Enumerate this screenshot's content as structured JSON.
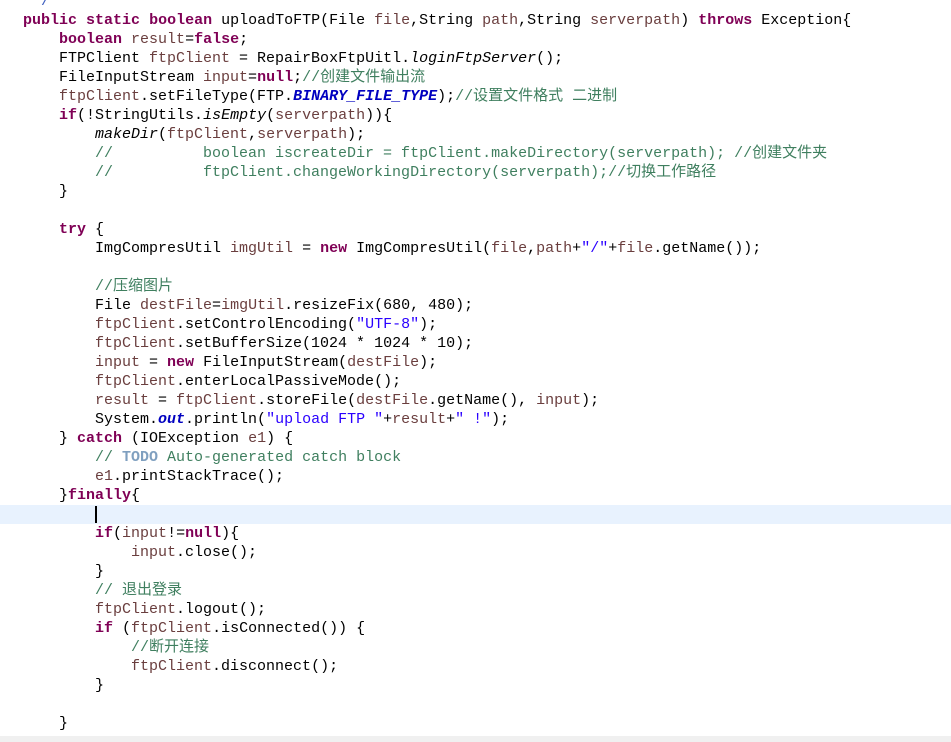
{
  "editor": {
    "current_line": 27,
    "lines": [
      [
        [
          " */",
          "j"
        ]
      ],
      [
        [
          "public",
          "k"
        ],
        [
          " ",
          "p"
        ],
        [
          "static",
          "k"
        ],
        [
          " ",
          "p"
        ],
        [
          "boolean",
          "k"
        ],
        [
          " uploadToFTP(File ",
          "p"
        ],
        [
          "file",
          "v"
        ],
        [
          ",String ",
          "p"
        ],
        [
          "path",
          "v"
        ],
        [
          ",String ",
          "p"
        ],
        [
          "serverpath",
          "v"
        ],
        [
          ") ",
          "p"
        ],
        [
          "throws",
          "k"
        ],
        [
          " Exception{",
          "p"
        ]
      ],
      [
        [
          "    ",
          "p"
        ],
        [
          "boolean",
          "k"
        ],
        [
          " ",
          "p"
        ],
        [
          "result",
          "v"
        ],
        [
          "=",
          "p"
        ],
        [
          "false",
          "k"
        ],
        [
          ";",
          "p"
        ]
      ],
      [
        [
          "    FTPClient ",
          "p"
        ],
        [
          "ftpClient",
          "v"
        ],
        [
          " = RepairBoxFtpUitl.",
          "p"
        ],
        [
          "loginFtpServer",
          "i"
        ],
        [
          "();",
          "p"
        ]
      ],
      [
        [
          "    FileInputStream ",
          "p"
        ],
        [
          "input",
          "v"
        ],
        [
          "=",
          "p"
        ],
        [
          "null",
          "k"
        ],
        [
          ";",
          "p"
        ],
        [
          "//创建文件输出流",
          "c"
        ]
      ],
      [
        [
          "    ",
          "p"
        ],
        [
          "ftpClient",
          "v"
        ],
        [
          ".setFileType(FTP.",
          "p"
        ],
        [
          "BINARY_FILE_TYPE",
          "f"
        ],
        [
          ");",
          "p"
        ],
        [
          "//设置文件格式 二进制",
          "c"
        ]
      ],
      [
        [
          "    ",
          "p"
        ],
        [
          "if",
          "k"
        ],
        [
          "(!StringUtils.",
          "p"
        ],
        [
          "isEmpty",
          "i"
        ],
        [
          "(",
          "p"
        ],
        [
          "serverpath",
          "v"
        ],
        [
          ")){",
          "p"
        ]
      ],
      [
        [
          "        ",
          "p"
        ],
        [
          "makeDir",
          "i"
        ],
        [
          "(",
          "p"
        ],
        [
          "ftpClient",
          "v"
        ],
        [
          ",",
          "p"
        ],
        [
          "serverpath",
          "v"
        ],
        [
          ");",
          "p"
        ]
      ],
      [
        [
          "        //          boolean iscreateDir = ftpClient.makeDirectory(serverpath); //创建文件夹",
          "c"
        ]
      ],
      [
        [
          "        //          ftpClient.changeWorkingDirectory(serverpath);//切换工作路径",
          "c"
        ]
      ],
      [
        [
          "    }",
          "p"
        ]
      ],
      [],
      [
        [
          "    ",
          "p"
        ],
        [
          "try",
          "k"
        ],
        [
          " {",
          "p"
        ]
      ],
      [
        [
          "        ImgCompresUtil ",
          "p"
        ],
        [
          "imgUtil",
          "v"
        ],
        [
          " = ",
          "p"
        ],
        [
          "new",
          "k"
        ],
        [
          " ImgCompresUtil(",
          "p"
        ],
        [
          "file",
          "v"
        ],
        [
          ",",
          "p"
        ],
        [
          "path",
          "v"
        ],
        [
          "+",
          "p"
        ],
        [
          "\"/\"",
          "s"
        ],
        [
          "+",
          "p"
        ],
        [
          "file",
          "v"
        ],
        [
          ".getName());",
          "p"
        ]
      ],
      [],
      [
        [
          "        //压缩图片",
          "c"
        ]
      ],
      [
        [
          "        File ",
          "p"
        ],
        [
          "destFile",
          "v"
        ],
        [
          "=",
          "p"
        ],
        [
          "imgUtil",
          "v"
        ],
        [
          ".resizeFix(680, 480);",
          "p"
        ]
      ],
      [
        [
          "        ",
          "p"
        ],
        [
          "ftpClient",
          "v"
        ],
        [
          ".setControlEncoding(",
          "p"
        ],
        [
          "\"UTF-8\"",
          "s"
        ],
        [
          ");",
          "p"
        ]
      ],
      [
        [
          "        ",
          "p"
        ],
        [
          "ftpClient",
          "v"
        ],
        [
          ".setBufferSize(1024 * 1024 * 10);",
          "p"
        ]
      ],
      [
        [
          "        ",
          "p"
        ],
        [
          "input",
          "v"
        ],
        [
          " = ",
          "p"
        ],
        [
          "new",
          "k"
        ],
        [
          " FileInputStream(",
          "p"
        ],
        [
          "destFile",
          "v"
        ],
        [
          ");",
          "p"
        ]
      ],
      [
        [
          "        ",
          "p"
        ],
        [
          "ftpClient",
          "v"
        ],
        [
          ".enterLocalPassiveMode();",
          "p"
        ]
      ],
      [
        [
          "        ",
          "p"
        ],
        [
          "result",
          "v"
        ],
        [
          " = ",
          "p"
        ],
        [
          "ftpClient",
          "v"
        ],
        [
          ".storeFile(",
          "p"
        ],
        [
          "destFile",
          "v"
        ],
        [
          ".getName(), ",
          "p"
        ],
        [
          "input",
          "v"
        ],
        [
          ");",
          "p"
        ]
      ],
      [
        [
          "        System.",
          "p"
        ],
        [
          "out",
          "f"
        ],
        [
          ".println(",
          "p"
        ],
        [
          "\"upload FTP \"",
          "s"
        ],
        [
          "+",
          "p"
        ],
        [
          "result",
          "v"
        ],
        [
          "+",
          "p"
        ],
        [
          "\" !\"",
          "s"
        ],
        [
          ");",
          "p"
        ]
      ],
      [
        [
          "    } ",
          "p"
        ],
        [
          "catch",
          "k"
        ],
        [
          " (IOException ",
          "p"
        ],
        [
          "e1",
          "v"
        ],
        [
          ") {",
          "p"
        ]
      ],
      [
        [
          "        // ",
          "c"
        ],
        [
          "TODO",
          "t"
        ],
        [
          " Auto-generated catch block",
          "c"
        ]
      ],
      [
        [
          "        ",
          "p"
        ],
        [
          "e1",
          "v"
        ],
        [
          ".printStackTrace();",
          "p"
        ]
      ],
      [
        [
          "    }",
          "p"
        ],
        [
          "finally",
          "k"
        ],
        [
          "{",
          "p"
        ]
      ],
      [],
      [
        [
          "        ",
          "p"
        ],
        [
          "if",
          "k"
        ],
        [
          "(",
          "p"
        ],
        [
          "input",
          "v"
        ],
        [
          "!=",
          "p"
        ],
        [
          "null",
          "k"
        ],
        [
          "){",
          "p"
        ]
      ],
      [
        [
          "            ",
          "p"
        ],
        [
          "input",
          "v"
        ],
        [
          ".close();",
          "p"
        ]
      ],
      [
        [
          "        }",
          "p"
        ]
      ],
      [
        [
          "        // 退出登录",
          "c"
        ]
      ],
      [
        [
          "        ",
          "p"
        ],
        [
          "ftpClient",
          "v"
        ],
        [
          ".logout();",
          "p"
        ]
      ],
      [
        [
          "        ",
          "p"
        ],
        [
          "if",
          "k"
        ],
        [
          " (",
          "p"
        ],
        [
          "ftpClient",
          "v"
        ],
        [
          ".isConnected()) {",
          "p"
        ]
      ],
      [
        [
          "            //断开连接",
          "c"
        ]
      ],
      [
        [
          "            ",
          "p"
        ],
        [
          "ftpClient",
          "v"
        ],
        [
          ".disconnect();",
          "p"
        ]
      ],
      [
        [
          "        }",
          "p"
        ]
      ],
      [],
      [
        [
          "    }",
          "p"
        ]
      ]
    ]
  }
}
